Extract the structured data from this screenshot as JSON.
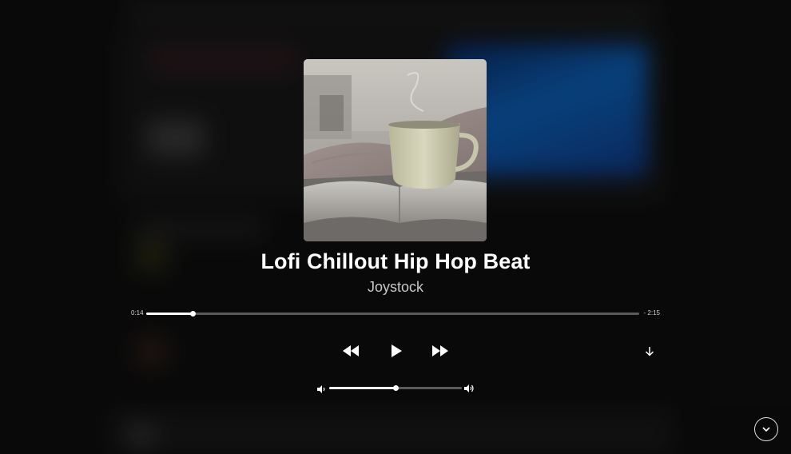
{
  "player": {
    "song_title": "Lofi Chillout Hip Hop Beat",
    "artist": "Joystock",
    "time_elapsed": "0:14",
    "time_remaining": "- 2:15",
    "progress": 0.095,
    "volume": 0.5
  },
  "icons": {
    "album_art": "coffee-cup-on-book-image",
    "rewind": "rewind-icon",
    "play": "play-icon",
    "forward": "fast-forward-icon",
    "download": "download-arrow-icon",
    "volume_low": "volume-low-icon",
    "volume_high": "volume-high-icon",
    "collapse": "chevron-down-icon"
  },
  "colors": {
    "background": "#0d0d0d",
    "text_primary": "#ffffff",
    "text_secondary": "#c8c8c8",
    "track": "#5b5b5b",
    "track_fill": "#ffffff"
  }
}
